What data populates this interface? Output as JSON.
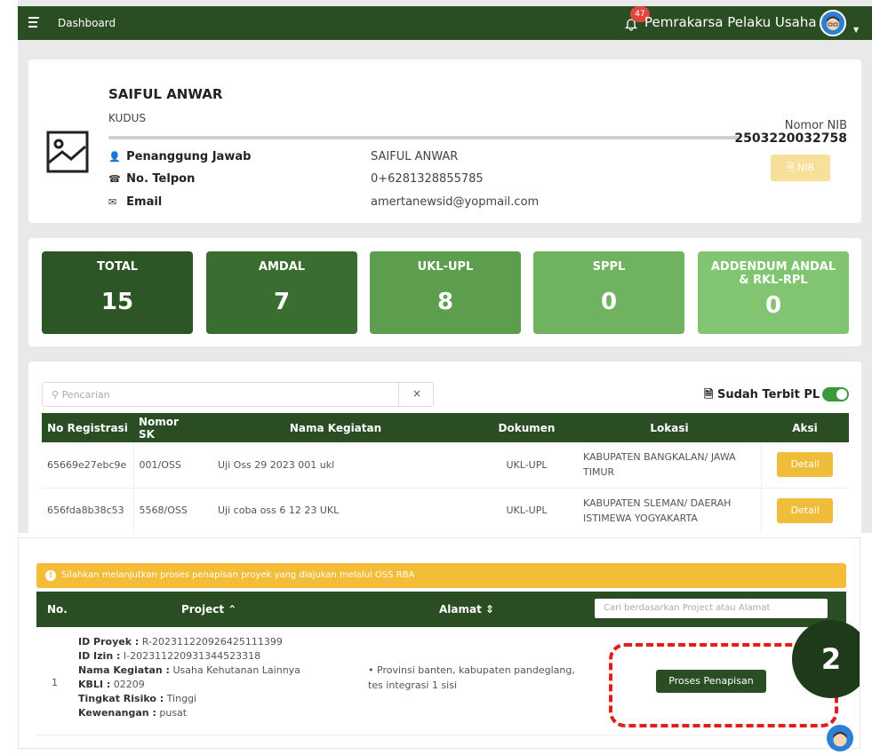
{
  "topbar": {
    "dashboard_label": "Dashboard",
    "notification_count": "47",
    "user_role": "Pemrakarsa Pelaku Usaha"
  },
  "profile": {
    "name": "SAIFUL ANWAR",
    "city": "KUDUS",
    "rows": [
      {
        "label": "Penanggung Jawab",
        "value": "SAIFUL ANWAR"
      },
      {
        "label": "No. Telpon",
        "value": "0+6281328855785"
      },
      {
        "label": "Email",
        "value": "amertanewsid@yopmail.com"
      }
    ],
    "nib_label": "Nomor NIB",
    "nib_value": "2503220032758",
    "nib_button": "NIB"
  },
  "stats": [
    {
      "label": "TOTAL",
      "value": "15",
      "color": "#2d5525"
    },
    {
      "label": "AMDAL",
      "value": "7",
      "color": "#3a6e31"
    },
    {
      "label": "UKL-UPL",
      "value": "8",
      "color": "#5c9d4e"
    },
    {
      "label": "SPPL",
      "value": "0",
      "color": "#6fb361"
    },
    {
      "label": "ADDENDUM ANDAL & RKL-RPL",
      "value": "0",
      "color": "#81c471"
    }
  ],
  "listing": {
    "search_placeholder": "Pencarian",
    "clear_label": "×",
    "toggle_label": "Sudah Terbit PL",
    "headers": [
      "No Registrasi",
      "Nomor SK",
      "Nama Kegiatan",
      "Dokumen",
      "Lokasi",
      "Aksi"
    ],
    "rows": [
      {
        "reg": "65669e27ebc9e",
        "sk": "001/OSS",
        "kegiatan": "Uji Oss 29 2023 001 ukl",
        "dokumen": "UKL-UPL",
        "lokasi": "KABUPATEN BANGKALAN/ JAWA TIMUR",
        "aksi": "Detail"
      },
      {
        "reg": "656fda8b38c53",
        "sk": "5568/OSS",
        "kegiatan": "Uji coba oss 6 12 23 UKL",
        "dokumen": "UKL-UPL",
        "lokasi": "KABUPATEN SLEMAN/ DAERAH ISTIMEWA YOGYAKARTA",
        "aksi": "Detail"
      }
    ]
  },
  "penapisan": {
    "alert": "Silahkan melanjutkan proses penapisan proyek yang diajukan melalui OSS RBA",
    "headers": {
      "no": "No.",
      "project": "Project ⌃",
      "alamat": "Alamat ⇕"
    },
    "search_placeholder": "Cari berdasarkan Project atau Alamat",
    "row": {
      "no": "1",
      "id_proyek_label": "ID Proyek :",
      "id_proyek": "R-202311220926425111399",
      "id_izin_label": "ID Izin :",
      "id_izin": "I-202311220931344523318",
      "nama_label": "Nama Kegiatan :",
      "nama": "Usaha Kehutanan Lainnya",
      "kbli_label": "KBLI :",
      "kbli": "02209",
      "risiko_label": "Tingkat Risiko :",
      "risiko": "Tinggi",
      "kewenangan_label": "Kewenangan :",
      "kewenangan": "pusat",
      "alamat": "Provinsi banten, kabupaten pandeglang, tes integrasi 1 sisi",
      "action": "Proses Penapisan"
    },
    "step_number": "2"
  }
}
